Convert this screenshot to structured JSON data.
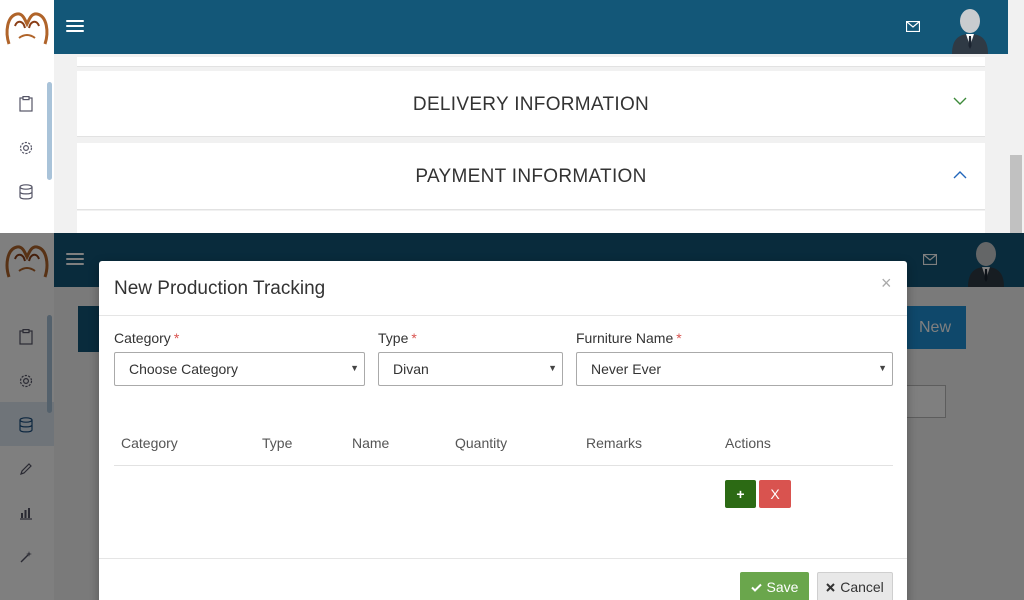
{
  "panels": {
    "delivery_title": "DELIVERY INFORMATION",
    "payment_title": "PAYMENT INFORMATION"
  },
  "background": {
    "new_button_label": "New"
  },
  "modal": {
    "title": "New Production Tracking",
    "close_glyph": "×",
    "fields": {
      "category_label": "Category",
      "category_value": "Choose Category",
      "type_label": "Type",
      "type_value": "Divan",
      "furniture_label": "Furniture Name",
      "furniture_value": "Never Ever",
      "required_mark": "*"
    },
    "table": {
      "headers": [
        "Category",
        "Type",
        "Name",
        "Quantity",
        "Remarks",
        "Actions"
      ]
    },
    "row_actions": {
      "add_label": "+",
      "remove_label": "X"
    },
    "footer": {
      "save_label": "Save",
      "cancel_label": "Cancel"
    }
  },
  "colors": {
    "topbar": "#135778",
    "accent_blue": "#1e90d6",
    "save_green": "#6aa64c",
    "add_green": "#2c6a14",
    "danger_red": "#d9534f"
  },
  "icons": [
    "hamburger-menu-icon",
    "mail-icon",
    "user-avatar-icon",
    "clipboard-icon",
    "gear-icon",
    "database-icon",
    "pencil-icon",
    "bar-chart-icon",
    "magic-wand-icon",
    "chevron-down-icon",
    "chevron-up-icon",
    "checkmark-icon",
    "close-icon"
  ]
}
